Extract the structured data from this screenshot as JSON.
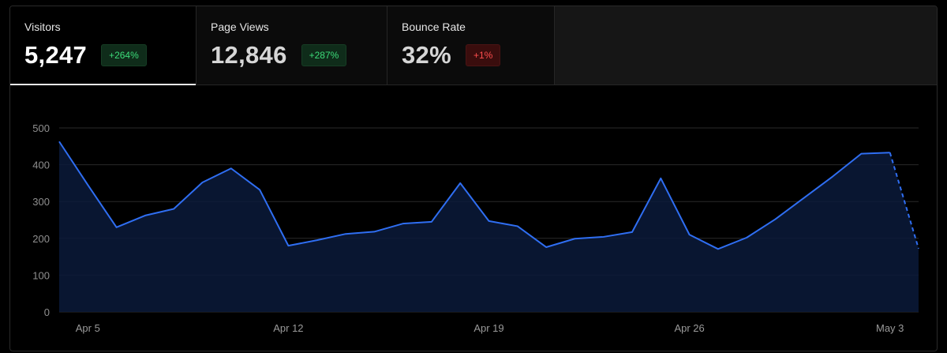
{
  "tabs": [
    {
      "label": "Visitors",
      "value": "5,247",
      "change": "+264%",
      "trend": "up",
      "active": true
    },
    {
      "label": "Page Views",
      "value": "12,846",
      "change": "+287%",
      "trend": "up",
      "active": false
    },
    {
      "label": "Bounce Rate",
      "value": "32%",
      "change": "+1%",
      "trend": "down",
      "active": false
    }
  ],
  "colors": {
    "line": "#2f6ef2",
    "area": "#0a1a3a",
    "grid": "#2a2a2a",
    "badge_up": "#3ddc7a",
    "badge_down": "#ff4d4d"
  },
  "chart_data": {
    "type": "area",
    "title": "",
    "xlabel": "",
    "ylabel": "",
    "ylim": [
      0,
      500
    ],
    "yticks": [
      0,
      100,
      200,
      300,
      400,
      500
    ],
    "x": [
      "Apr 4",
      "Apr 5",
      "Apr 6",
      "Apr 7",
      "Apr 8",
      "Apr 9",
      "Apr 10",
      "Apr 11",
      "Apr 12",
      "Apr 13",
      "Apr 14",
      "Apr 15",
      "Apr 16",
      "Apr 17",
      "Apr 18",
      "Apr 19",
      "Apr 20",
      "Apr 21",
      "Apr 22",
      "Apr 23",
      "Apr 24",
      "Apr 25",
      "Apr 26",
      "Apr 27",
      "Apr 28",
      "Apr 29",
      "Apr 30",
      "May 1",
      "May 2",
      "May 3",
      "May 4"
    ],
    "xticks": [
      "Apr 5",
      "Apr 12",
      "Apr 19",
      "Apr 26",
      "May 3"
    ],
    "series": [
      {
        "values": [
          463,
          345,
          230,
          262,
          280,
          352,
          390,
          332,
          180,
          195,
          212,
          218,
          240,
          245,
          350,
          247,
          233,
          176,
          199,
          204,
          217,
          363,
          210,
          171,
          202,
          252,
          310,
          368,
          430,
          433,
          172
        ],
        "dashed_from_index": 29
      }
    ],
    "grid": true,
    "legend": "none"
  }
}
